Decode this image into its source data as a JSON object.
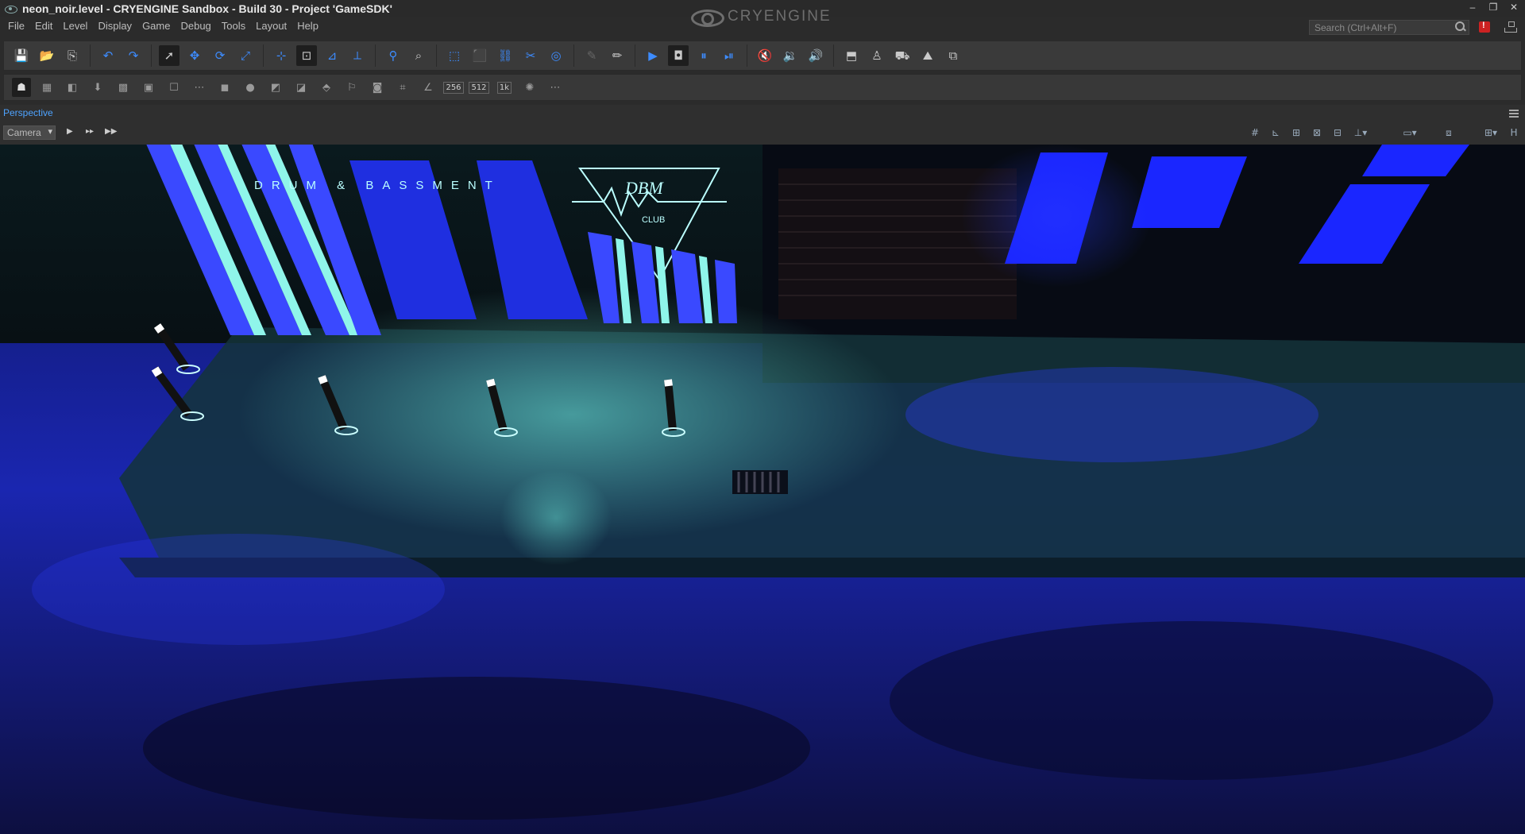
{
  "window": {
    "title": "neon_noir.level - CRYENGINE Sandbox - Build 30 - Project 'GameSDK'",
    "brand": "CRYENGINE",
    "controls": [
      "–",
      "❐",
      "✕"
    ]
  },
  "menu": {
    "items": [
      "File",
      "Edit",
      "Level",
      "Display",
      "Game",
      "Debug",
      "Tools",
      "Layout",
      "Help"
    ],
    "search_placeholder": "Search (Ctrl+Alt+F)"
  },
  "toolbar_main": {
    "groups": [
      [
        "save-icon",
        "open-folder-icon",
        "export-icon"
      ],
      [
        "undo-icon",
        "redo-icon"
      ],
      [
        "select-icon",
        "move-icon",
        "rotate-icon",
        "scale-icon"
      ],
      [
        "snap-grid-icon",
        "snap-object-icon",
        "snap-terrain-icon",
        "snap-normal-icon"
      ],
      [
        "goto-selection-icon",
        "zoom-icon"
      ],
      [
        "align-icon",
        "align-to-object-icon",
        "link-icon",
        "unlink-icon",
        "pivot-icon"
      ],
      [
        "paint-brush-icon",
        "pencil-icon"
      ],
      [
        "simulate-icon",
        "physics-icon",
        "ai-pause-icon",
        "ai-step-icon"
      ],
      [
        "mute-icon",
        "volume-low-icon",
        "volume-high-icon"
      ],
      [
        "toggle-helpers-icon",
        "character-icon",
        "vehicle-icon",
        "terrain-icon",
        "collision-icon"
      ]
    ]
  },
  "toolbar_display": {
    "texel_labels": [
      "256",
      "512",
      "1k"
    ]
  },
  "viewport": {
    "tab_label": "Perspective",
    "camera_label": "Camera",
    "scene": {
      "sign_text": "DRUM & BASSMENT",
      "logo_text": "DBM",
      "logo_subtext": "CLUB"
    }
  },
  "colors": {
    "accent_blue": "#3d8cff",
    "neon_blue": "#1a2cff",
    "neon_cyan": "#6ff0e0"
  }
}
